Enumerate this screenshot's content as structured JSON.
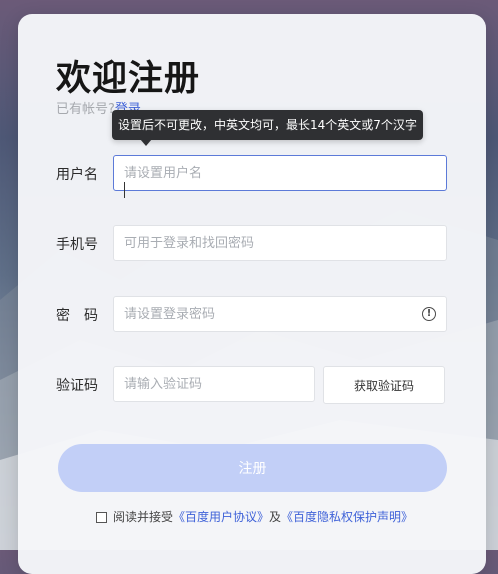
{
  "page": {
    "title": "欢迎注册",
    "have_account_text": "已有帐号?",
    "login_link": "登录"
  },
  "tooltip": {
    "text": "设置后不可更改，中英文均可，最长14个英文或7个汉字"
  },
  "form": {
    "username": {
      "label": "用户名",
      "placeholder": "请设置用户名",
      "value": ""
    },
    "phone": {
      "label": "手机号",
      "placeholder": "可用于登录和找回密码",
      "value": ""
    },
    "password": {
      "label": "密　码",
      "placeholder": "请设置登录密码",
      "value": ""
    },
    "code": {
      "label": "验证码",
      "placeholder": "请输入验证码",
      "value": ""
    },
    "get_code_label": "获取验证码",
    "submit_label": "注册"
  },
  "agreement": {
    "prefix": "阅读并接受",
    "user_agreement": "《百度用户协议》",
    "and": "及",
    "privacy": "《百度隐私权保护声明》",
    "checked": false
  },
  "colors": {
    "accent": "#3f62d8",
    "register_button": "#c2cff7",
    "tooltip_bg": "#2f3033"
  },
  "icons": {
    "password_hint": "info-circle-icon"
  }
}
